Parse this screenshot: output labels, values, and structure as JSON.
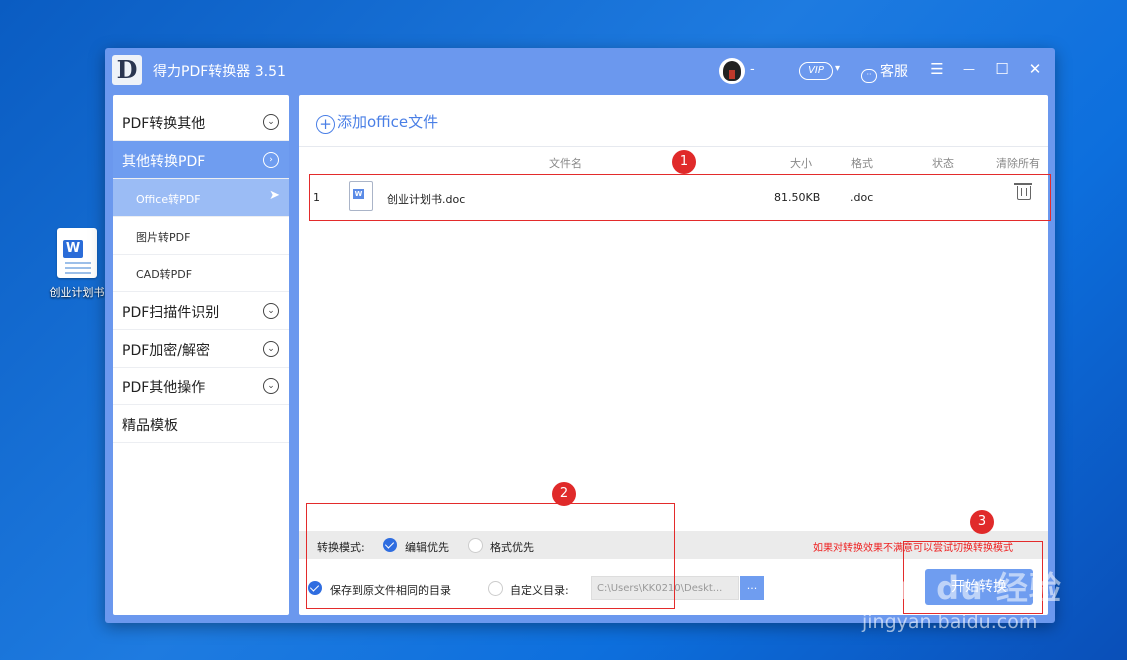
{
  "desktop": {
    "icon_label": "创业计划书",
    "icon_glyph": "W"
  },
  "window": {
    "logo": "D",
    "title": "得力PDF转换器 3.51",
    "user_dash": "-",
    "vip": "VIP",
    "vip_caret": "▾",
    "service": "客服",
    "controls": {
      "menu": "☰",
      "minimize": "—",
      "maximize": "☐",
      "close": "✕"
    }
  },
  "sidebar": {
    "items": [
      {
        "label": "PDF转换其他",
        "icon": "chevron-down-circle-icon",
        "glyph": "⌄"
      },
      {
        "label": "其他转换PDF",
        "icon": "chevron-right-circle-icon",
        "glyph": "›"
      },
      {
        "label": "PDF扫描件识别",
        "icon": "chevron-down-circle-icon",
        "glyph": "⌄"
      },
      {
        "label": "PDF加密/解密",
        "icon": "chevron-down-circle-icon",
        "glyph": "⌄"
      },
      {
        "label": "PDF其他操作",
        "icon": "chevron-down-circle-icon",
        "glyph": "⌄"
      },
      {
        "label": "精品模板"
      }
    ],
    "subitems": [
      {
        "label": "Office转PDF",
        "arrow": "➤"
      },
      {
        "label": "图片转PDF"
      },
      {
        "label": "CAD转PDF"
      }
    ]
  },
  "main": {
    "add_button": "添加office文件",
    "add_icon": "+",
    "columns": {
      "filename": "文件名",
      "size": "大小",
      "format": "格式",
      "status": "状态",
      "clear": "清除所有"
    },
    "files": [
      {
        "index": "1",
        "name": "创业计划书.doc",
        "size": "81.50KB",
        "format": ".doc",
        "status": "",
        "icon_glyph": "W"
      }
    ],
    "mode": {
      "label": "转换模式:",
      "option_edit": "编辑优先",
      "option_format": "格式优先",
      "selected": "编辑优先",
      "warning": "如果对转换效果不满意可以尝试切换转换模式"
    },
    "output": {
      "same_dir": "保存到原文件相同的目录",
      "custom_dir": "自定义目录:",
      "path": "C:\\Users\\KK0210\\Deskt...",
      "browse": "..."
    },
    "convert_button": "开始转换"
  },
  "annotations": {
    "badge1": "1",
    "badge2": "2",
    "badge3": "3"
  },
  "watermark": {
    "line1": "Bai du 经验",
    "line2": "jingyan.baidu.com"
  },
  "colors": {
    "accent": "#6f9df0",
    "brand_blue": "#4a7fe6",
    "annotation_red": "#e32b2b"
  }
}
